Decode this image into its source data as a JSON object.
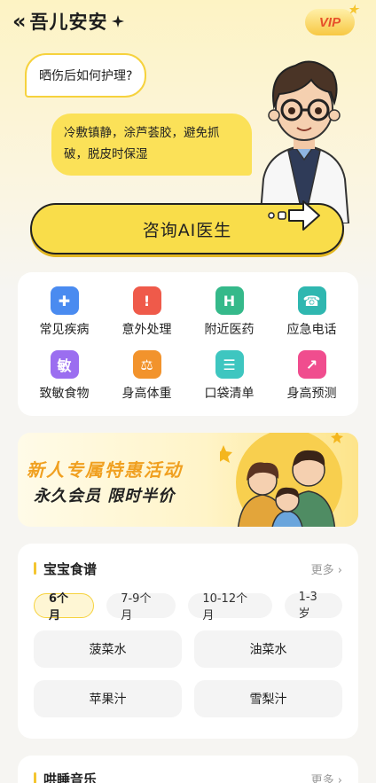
{
  "header": {
    "back_icon": "double-chevron-left",
    "title": "吾儿安安",
    "vip": "VIP"
  },
  "chat": {
    "question": "晒伤后如何护理?",
    "answer": "冷敷镇静，涂芦荟胶，避免抓破，脱皮时保湿",
    "cta": "咨询AI医生"
  },
  "tools": [
    {
      "label": "常见疾病",
      "icon": "book-medical-icon",
      "color": "#4a8bf0"
    },
    {
      "label": "意外处理",
      "icon": "alarm-light-icon",
      "color": "#ef5a4a"
    },
    {
      "label": "附近医药",
      "icon": "hospital-icon",
      "color": "#35b98a"
    },
    {
      "label": "应急电话",
      "icon": "phone-icon",
      "color": "#2fb7b0"
    },
    {
      "label": "致敏食物",
      "icon": "allergy-icon",
      "color": "#9b6ef0"
    },
    {
      "label": "身高体重",
      "icon": "scale-icon",
      "color": "#f2932c"
    },
    {
      "label": "口袋清单",
      "icon": "checklist-icon",
      "color": "#3ec6c0"
    },
    {
      "label": "身高预测",
      "icon": "growth-chart-icon",
      "color": "#f04d8e"
    }
  ],
  "banner": {
    "line1": "新人专属特惠活动",
    "line2": "永久会员 限时半价"
  },
  "recipes": {
    "title": "宝宝食谱",
    "more": "更多",
    "tabs": [
      "6个月",
      "7-9个月",
      "10-12个月",
      "1-3岁"
    ],
    "active_tab": 0,
    "items": [
      "菠菜水",
      "油菜水",
      "苹果汁",
      "雪梨汁"
    ]
  },
  "music": {
    "title": "哄睡音乐",
    "more": "更多"
  },
  "colors": {
    "accent": "#f9dd4a",
    "bg": "#f6f5f2"
  }
}
